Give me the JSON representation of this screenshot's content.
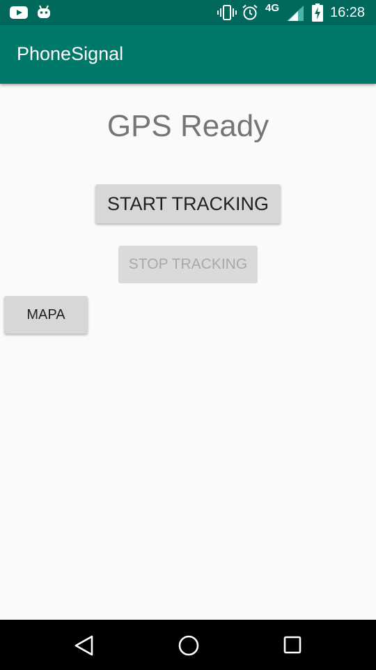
{
  "status_bar": {
    "left_icons": [
      "youtube-icon",
      "android-icon"
    ],
    "right_icons": [
      "vibrate-icon",
      "alarm-icon",
      "signal-icon",
      "battery-charging-icon"
    ],
    "network": "4G",
    "time": "16:28"
  },
  "app_bar": {
    "title": "PhoneSignal",
    "color": "#00796b"
  },
  "main": {
    "status_text": "GPS Ready",
    "start_button": "START TRACKING",
    "stop_button": "STOP TRACKING",
    "mapa_button": "MAPA"
  },
  "nav_bar": {
    "icons": [
      "back-icon",
      "home-icon",
      "recents-icon"
    ]
  }
}
